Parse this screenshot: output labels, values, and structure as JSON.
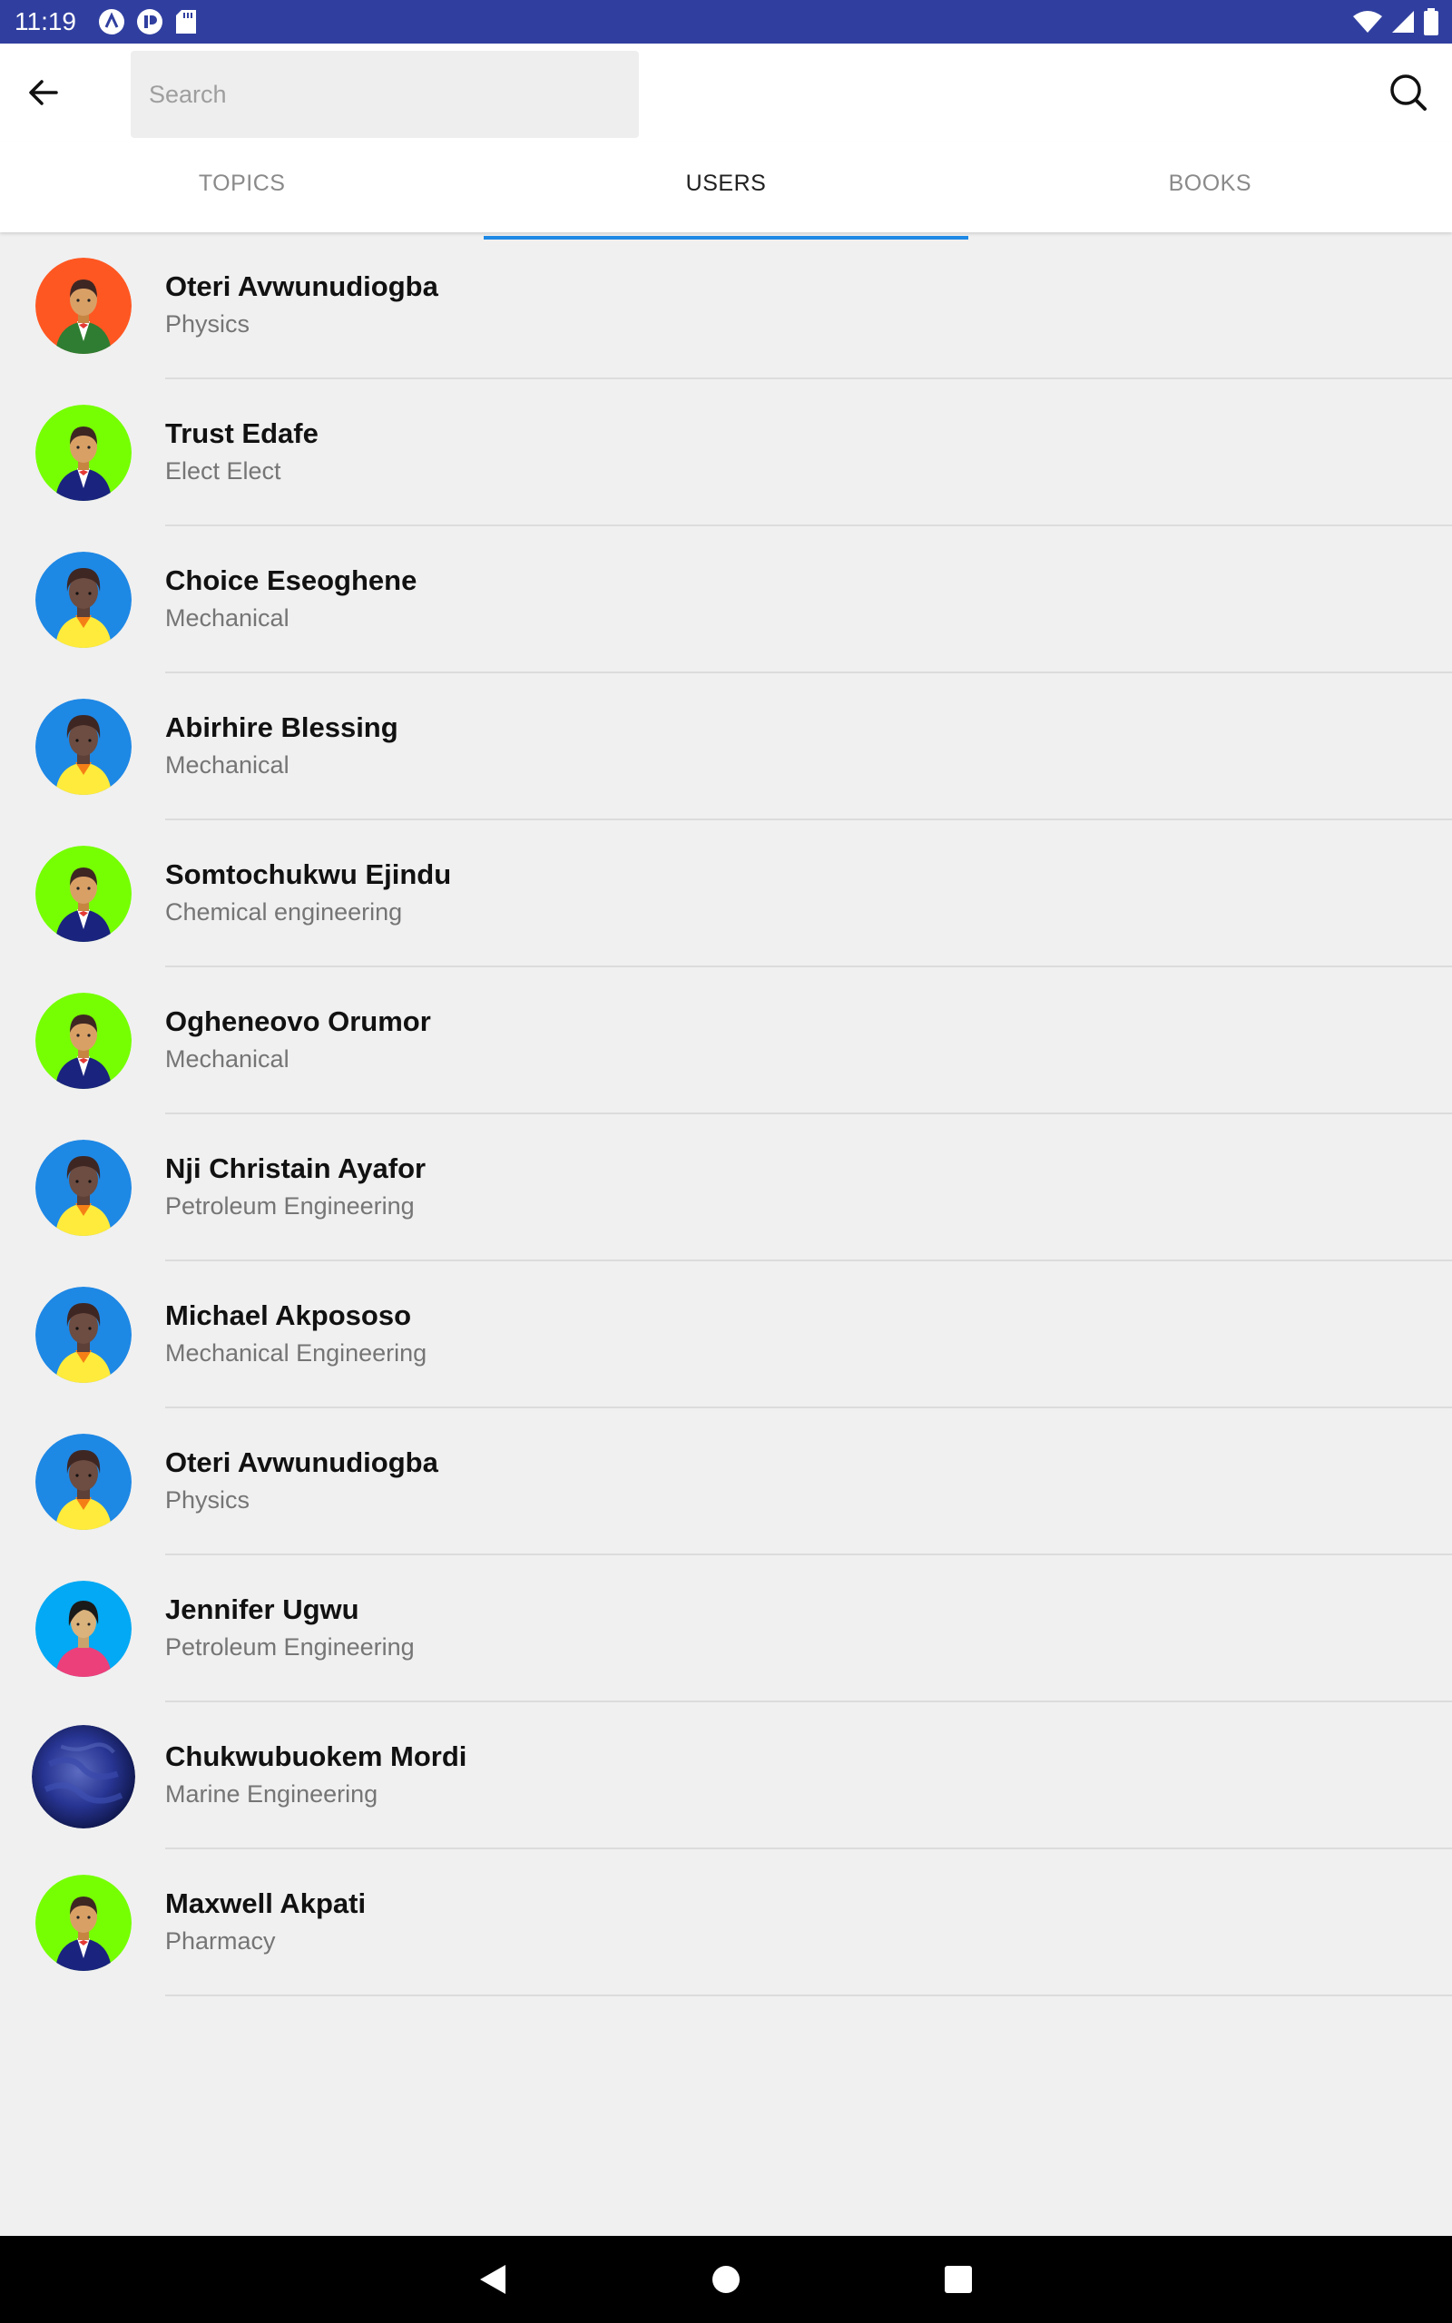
{
  "status_bar": {
    "time": "11:19",
    "notification_icons": [
      "app-a-icon",
      "app-p-icon",
      "sd-card-icon"
    ],
    "system_icons": [
      "wifi-icon",
      "cell-signal-icon",
      "battery-icon"
    ],
    "bg_color": "#303f9f"
  },
  "toolbar": {
    "back_icon": "arrow-left-icon",
    "search_placeholder": "Search",
    "search_value": "",
    "search_icon": "search-icon"
  },
  "tabs": [
    {
      "label": "TOPICS",
      "active": false
    },
    {
      "label": "USERS",
      "active": true
    },
    {
      "label": "BOOKS",
      "active": false
    }
  ],
  "accent_color": "#1e88e5",
  "users": [
    {
      "name": "Oteri Avwunudiogba",
      "subject": "Physics",
      "avatar": "man-green-suit-avatar",
      "avatar_bg": "#ff5722"
    },
    {
      "name": "Trust Edafe",
      "subject": "Elect Elect",
      "avatar": "man-blue-suit-avatar",
      "avatar_bg": "#76ff03"
    },
    {
      "name": "Choice Eseoghene",
      "subject": "Mechanical",
      "avatar": "man-yellow-shirt-avatar",
      "avatar_bg": "#1e88e5"
    },
    {
      "name": "Abirhire Blessing",
      "subject": "Mechanical",
      "avatar": "man-yellow-shirt-avatar",
      "avatar_bg": "#1e88e5"
    },
    {
      "name": "Somtochukwu Ejindu",
      "subject": "Chemical engineering",
      "avatar": "man-blue-suit-avatar",
      "avatar_bg": "#76ff03"
    },
    {
      "name": "Ogheneovo Orumor",
      "subject": "Mechanical",
      "avatar": "man-blue-suit-avatar",
      "avatar_bg": "#76ff03"
    },
    {
      "name": "Nji Christain Ayafor",
      "subject": "Petroleum Engineering",
      "avatar": "man-yellow-shirt-avatar",
      "avatar_bg": "#1e88e5"
    },
    {
      "name": "Michael  Akpososo",
      "subject": "Mechanical Engineering",
      "avatar": "man-yellow-shirt-avatar",
      "avatar_bg": "#1e88e5"
    },
    {
      "name": "Oteri Avwunudiogba",
      "subject": "Physics",
      "avatar": "man-yellow-shirt-avatar",
      "avatar_bg": "#1e88e5"
    },
    {
      "name": "Jennifer Ugwu",
      "subject": "Petroleum Engineering",
      "avatar": "woman-pink-shirt-avatar",
      "avatar_bg": "#03a9f4"
    },
    {
      "name": "Chukwubuokem Mordi",
      "subject": "Marine Engineering",
      "avatar": "photo-avatar",
      "avatar_bg": "#283593"
    },
    {
      "name": "Maxwell Akpati",
      "subject": "Pharmacy",
      "avatar": "man-blue-suit-avatar",
      "avatar_bg": "#76ff03"
    }
  ],
  "nav_bar": {
    "buttons": [
      "back-triangle-icon",
      "home-circle-icon",
      "recents-square-icon"
    ]
  }
}
